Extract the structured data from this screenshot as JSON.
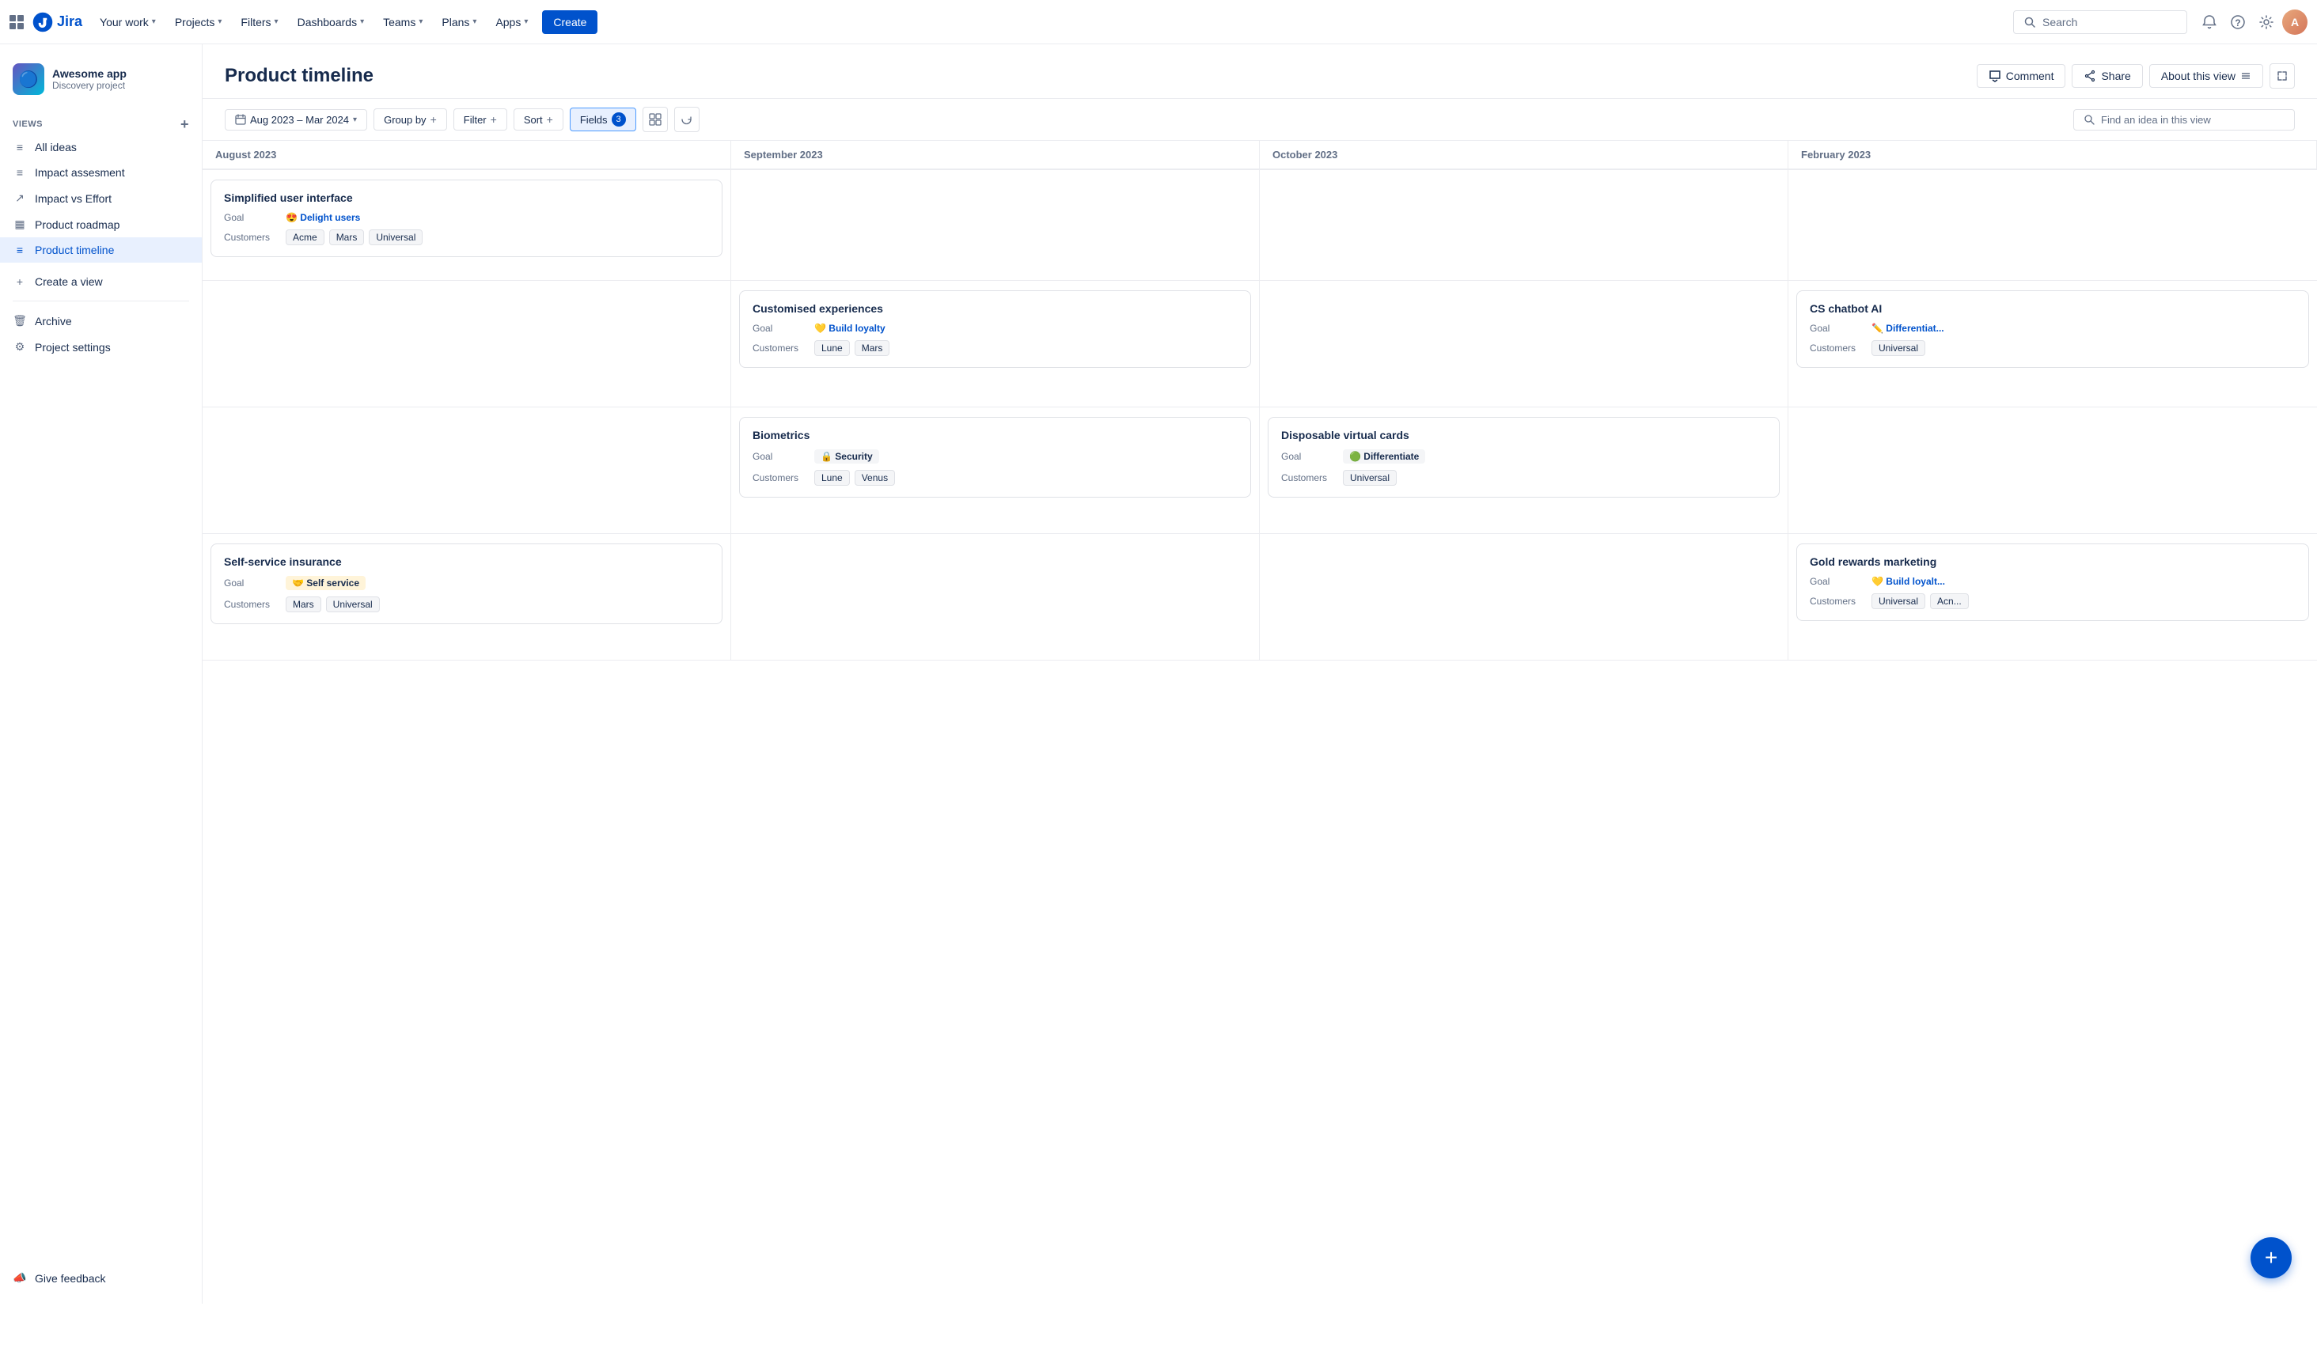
{
  "nav": {
    "logo_text": "Jira",
    "items": [
      {
        "label": "Your work",
        "id": "your-work"
      },
      {
        "label": "Projects",
        "id": "projects"
      },
      {
        "label": "Filters",
        "id": "filters"
      },
      {
        "label": "Dashboards",
        "id": "dashboards"
      },
      {
        "label": "Teams",
        "id": "teams"
      },
      {
        "label": "Plans",
        "id": "plans"
      },
      {
        "label": "Apps",
        "id": "apps"
      }
    ],
    "create_label": "Create",
    "search_placeholder": "Search"
  },
  "sidebar": {
    "project_name": "Awesome app",
    "project_type": "Discovery project",
    "views_label": "VIEWS",
    "items": [
      {
        "label": "All ideas",
        "id": "all-ideas",
        "icon": "≡"
      },
      {
        "label": "Impact assesment",
        "id": "impact-assessment",
        "icon": "≡"
      },
      {
        "label": "Impact vs Effort",
        "id": "impact-effort",
        "icon": "↗"
      },
      {
        "label": "Product roadmap",
        "id": "product-roadmap",
        "icon": "▦"
      },
      {
        "label": "Product timeline",
        "id": "product-timeline",
        "icon": "≡",
        "active": true
      }
    ],
    "create_view_label": "Create a view",
    "archive_label": "Archive",
    "settings_label": "Project settings",
    "feedback_label": "Give feedback"
  },
  "page": {
    "title": "Product timeline",
    "comment_label": "Comment",
    "share_label": "Share",
    "about_label": "About this view",
    "date_range": "Aug 2023 – Mar 2024",
    "group_by_label": "Group by",
    "filter_label": "Filter",
    "sort_label": "Sort",
    "fields_label": "Fields",
    "fields_count": "3",
    "search_placeholder": "Find an idea in this view"
  },
  "timeline": {
    "months": [
      {
        "label": "August 2023"
      },
      {
        "label": "September 2023"
      },
      {
        "label": "October 2023"
      },
      {
        "label": "February 2023"
      }
    ],
    "rows": [
      {
        "cards_col0": [
          {
            "title": "Simplified user interface",
            "goal_emoji": "😍",
            "goal_text": "Delight users",
            "goal_color": "#0052cc",
            "customers": [
              "Acme",
              "Mars",
              "Universal"
            ]
          }
        ],
        "cards_col1": [],
        "cards_col2": [],
        "cards_col3": []
      },
      {
        "cards_col0": [],
        "cards_col1": [
          {
            "title": "Customised experiences",
            "goal_emoji": "💛",
            "goal_text": "Build loyalty",
            "goal_color": "#0052cc",
            "customers": [
              "Lune",
              "Mars"
            ]
          }
        ],
        "cards_col2": [],
        "cards_col3": [
          {
            "title": "CS chatbot AI",
            "goal_emoji": "✏️",
            "goal_text": "Differentiat...",
            "goal_color": "#0052cc",
            "customers": [
              "Universal"
            ]
          }
        ]
      },
      {
        "cards_col0": [],
        "cards_col1": [
          {
            "title": "Biometrics",
            "goal_emoji": "🔒",
            "goal_text": "Security",
            "goal_color": "#0052cc",
            "customers": [
              "Lune",
              "Venus"
            ]
          }
        ],
        "cards_col2": [
          {
            "title": "Disposable virtual cards",
            "goal_emoji": "🟢",
            "goal_text": "Differentiate",
            "goal_color": "#0052cc",
            "customers": [
              "Universal"
            ]
          }
        ],
        "cards_col3": []
      },
      {
        "cards_col0": [
          {
            "title": "Self-service insurance",
            "goal_emoji": "🤝",
            "goal_text": "Self service",
            "goal_color": "#0052cc",
            "customers": [
              "Mars",
              "Universal"
            ]
          }
        ],
        "cards_col1": [],
        "cards_col2": [],
        "cards_col3": [
          {
            "title": "Gold rewards marketing",
            "goal_emoji": "💛",
            "goal_text": "Build loyalt...",
            "goal_color": "#0052cc",
            "customers": [
              "Universal",
              "Acn..."
            ]
          }
        ]
      }
    ]
  }
}
